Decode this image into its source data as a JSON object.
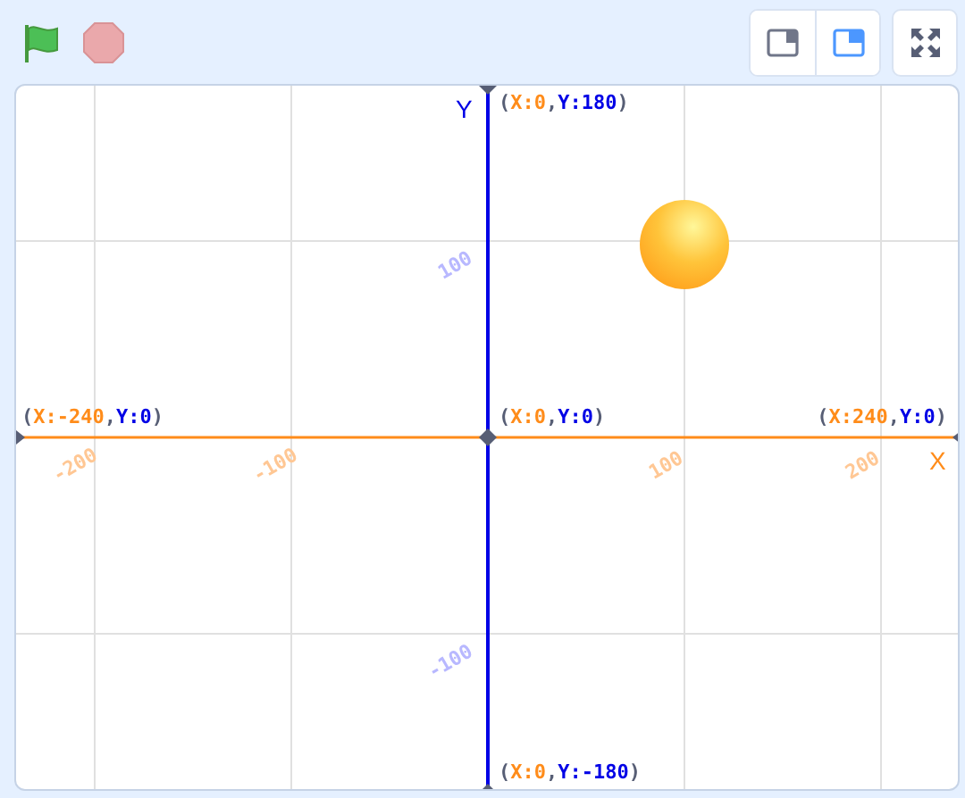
{
  "toolbar": {
    "controls": [
      {
        "kind": "flag"
      },
      {
        "kind": "stop"
      }
    ],
    "layout_buttons": [
      {
        "kind": "small",
        "selected": false
      },
      {
        "kind": "normal",
        "selected": true
      }
    ]
  },
  "stage": {
    "x_axis_label": "X",
    "y_axis_label": "Y",
    "coordinate_labels": [
      {
        "kind": "top",
        "parts": [
          "(",
          "X:0",
          ",",
          "Y:180",
          ")"
        ]
      },
      {
        "kind": "left",
        "parts": [
          "(",
          "X:-240",
          ",",
          "Y:0",
          ")"
        ]
      },
      {
        "kind": "center",
        "parts": [
          "(",
          "X:0",
          ",",
          "Y:0",
          ")"
        ]
      },
      {
        "kind": "right",
        "parts": [
          "(",
          "X:240",
          ",",
          "Y:0",
          ")"
        ]
      },
      {
        "kind": "bottom",
        "parts": [
          "(",
          "X:0",
          ",",
          "Y:-180",
          ")"
        ]
      }
    ],
    "x_ticks": [
      "-200",
      "-100",
      "100",
      "200"
    ],
    "y_ticks": [
      "100",
      "-100"
    ]
  }
}
